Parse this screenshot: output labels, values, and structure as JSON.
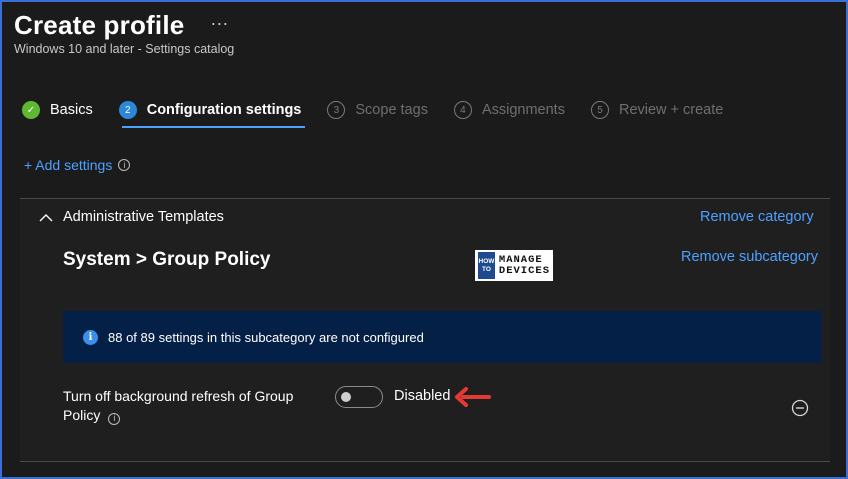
{
  "header": {
    "title": "Create profile",
    "more_label": "···",
    "subtitle": "Windows 10 and later - Settings catalog"
  },
  "steps": [
    {
      "number": "✓",
      "label": "Basics",
      "state": "done"
    },
    {
      "number": "2",
      "label": "Configuration settings",
      "state": "active"
    },
    {
      "number": "3",
      "label": "Scope tags",
      "state": "pending"
    },
    {
      "number": "4",
      "label": "Assignments",
      "state": "pending"
    },
    {
      "number": "5",
      "label": "Review + create",
      "state": "pending"
    }
  ],
  "add_settings": {
    "label": "+ Add settings",
    "info_icon": "info-icon"
  },
  "category": {
    "title": "Administrative Templates",
    "remove_label": "Remove category",
    "subcategory_title": "System > Group Policy",
    "remove_sub_label": "Remove subcategory"
  },
  "logo": {
    "left_top": "HOW",
    "left_bottom": "TO",
    "line1": "MANAGE",
    "line2": "DEVICES"
  },
  "banner": {
    "icon": "i",
    "text": "88 of 89 settings in this subcategory are not configured"
  },
  "setting": {
    "label": "Turn off background refresh of Group Policy",
    "toggle_state": "Disabled",
    "toggle_on": false
  },
  "colors": {
    "accent": "#4ea1ff",
    "done": "#5fb832",
    "active_step": "#2b88d8",
    "banner_bg": "#052047",
    "annotation_arrow": "#e53935",
    "frame_border": "#3a6fd8"
  }
}
